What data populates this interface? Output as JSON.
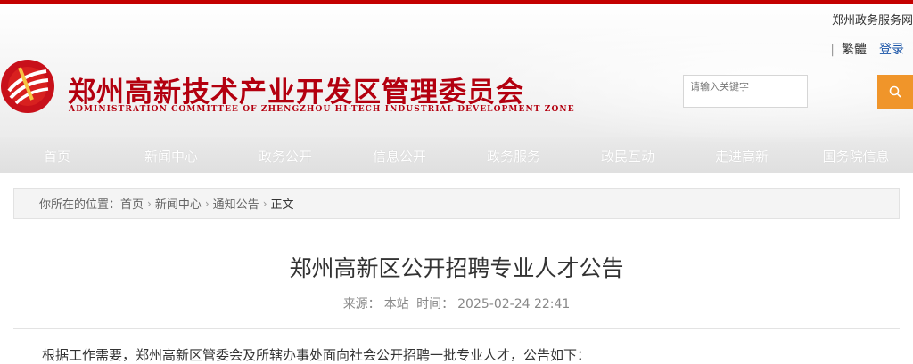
{
  "top_links": {
    "site_link": "郑州政务服务网",
    "separator": "|",
    "traditional": "繁體",
    "login": "登录"
  },
  "brand": {
    "title": "郑州高新技术产业开发区管理委员会",
    "subtitle": "ADMINISTRATION COMMITTEE OF ZHENGZHOU HI-TECH INDUSTRIAL DEVELOPMENT ZONE",
    "logo_icon": "zhengzhou-hitech-emblem-icon",
    "brand_color": "#b3000f"
  },
  "search": {
    "placeholder": "请输入关键字",
    "button_icon": "search-icon",
    "button_color": "#f0952a"
  },
  "nav": {
    "items": [
      {
        "label": "首页"
      },
      {
        "label": "新闻中心"
      },
      {
        "label": "政务公开"
      },
      {
        "label": "信息公开"
      },
      {
        "label": "政务服务"
      },
      {
        "label": "政民互动"
      },
      {
        "label": "走进高新"
      },
      {
        "label": "国务院信息"
      }
    ]
  },
  "breadcrumb": {
    "prefix": "你所在的位置：",
    "items": [
      {
        "label": "首页"
      },
      {
        "label": "新闻中心"
      },
      {
        "label": "通知公告"
      }
    ],
    "current": "正文"
  },
  "article": {
    "title": "郑州高新区公开招聘专业人才公告",
    "source_label": "来源：",
    "source": "本站",
    "time_label": "时间：",
    "time": "2025-02-24 22:41",
    "first_line": "根据工作需要，郑州高新区管委会及所辖办事处面向社会公开招聘一批专业人才，公告如下："
  }
}
